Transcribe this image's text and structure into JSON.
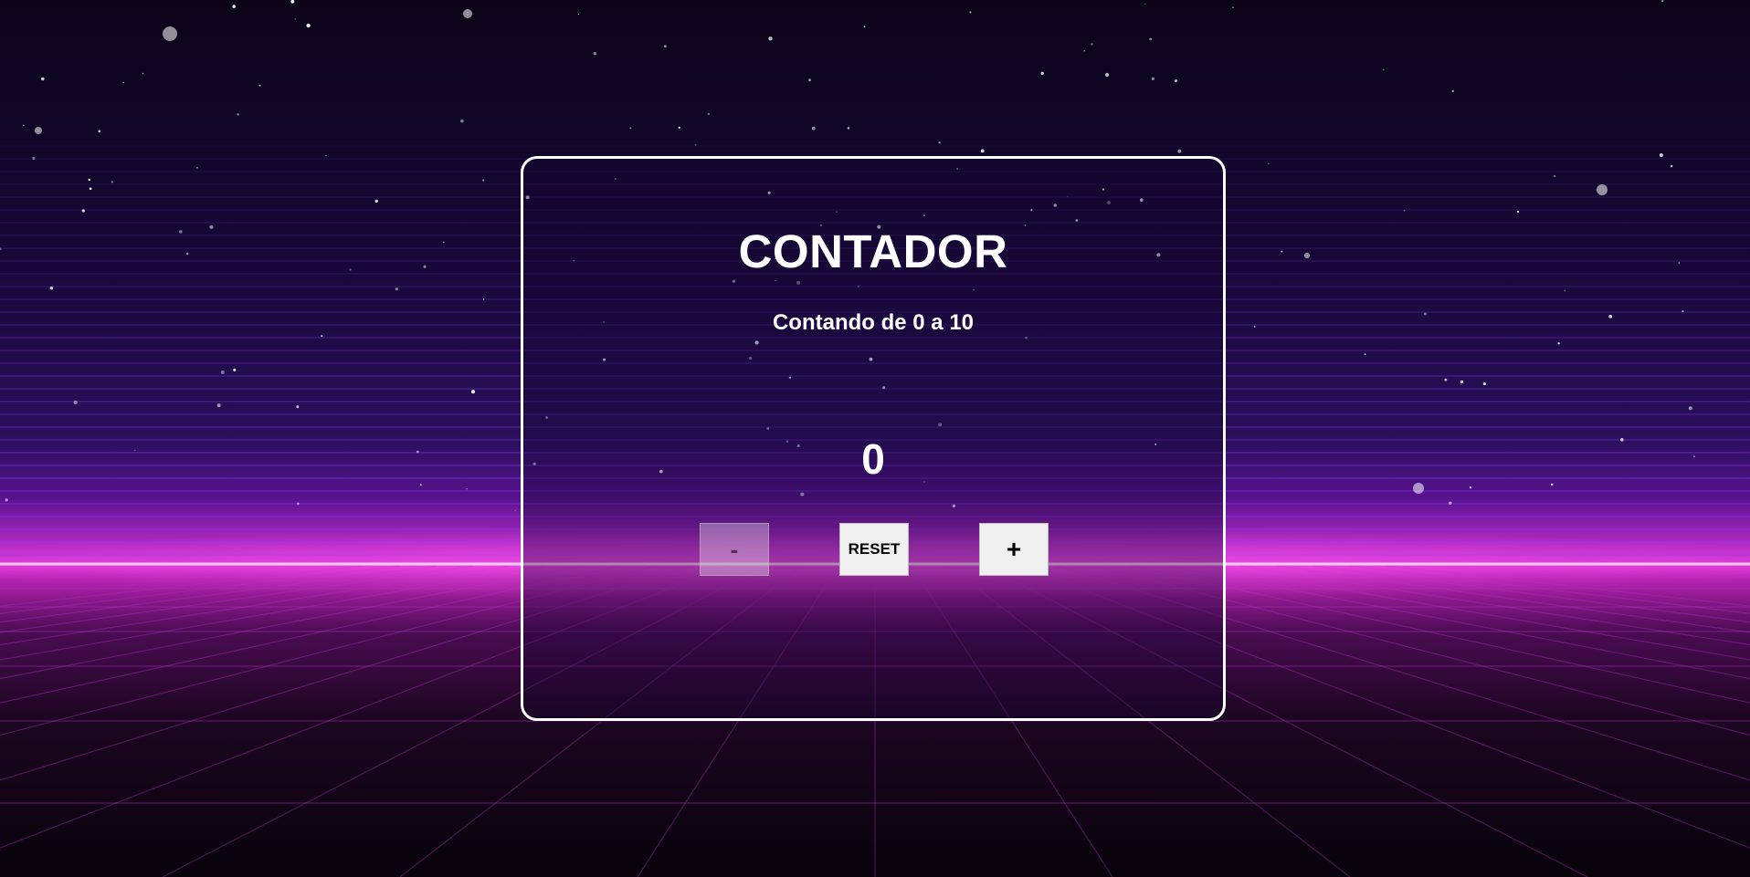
{
  "app": {
    "title": "CONTADOR",
    "subtitle": "Contando de 0 a 10"
  },
  "counter": {
    "value": "0",
    "min": 0,
    "max": 10
  },
  "controls": {
    "decrement_label": "-",
    "reset_label": "RESET",
    "increment_label": "+",
    "decrement_disabled": true
  },
  "theme": {
    "background": "#0b0418",
    "accent_magenta": "#e03ad8",
    "grid_purple": "#7a2fd8",
    "card_border": "#ffffff",
    "button_bg": "#f0f0f0"
  }
}
